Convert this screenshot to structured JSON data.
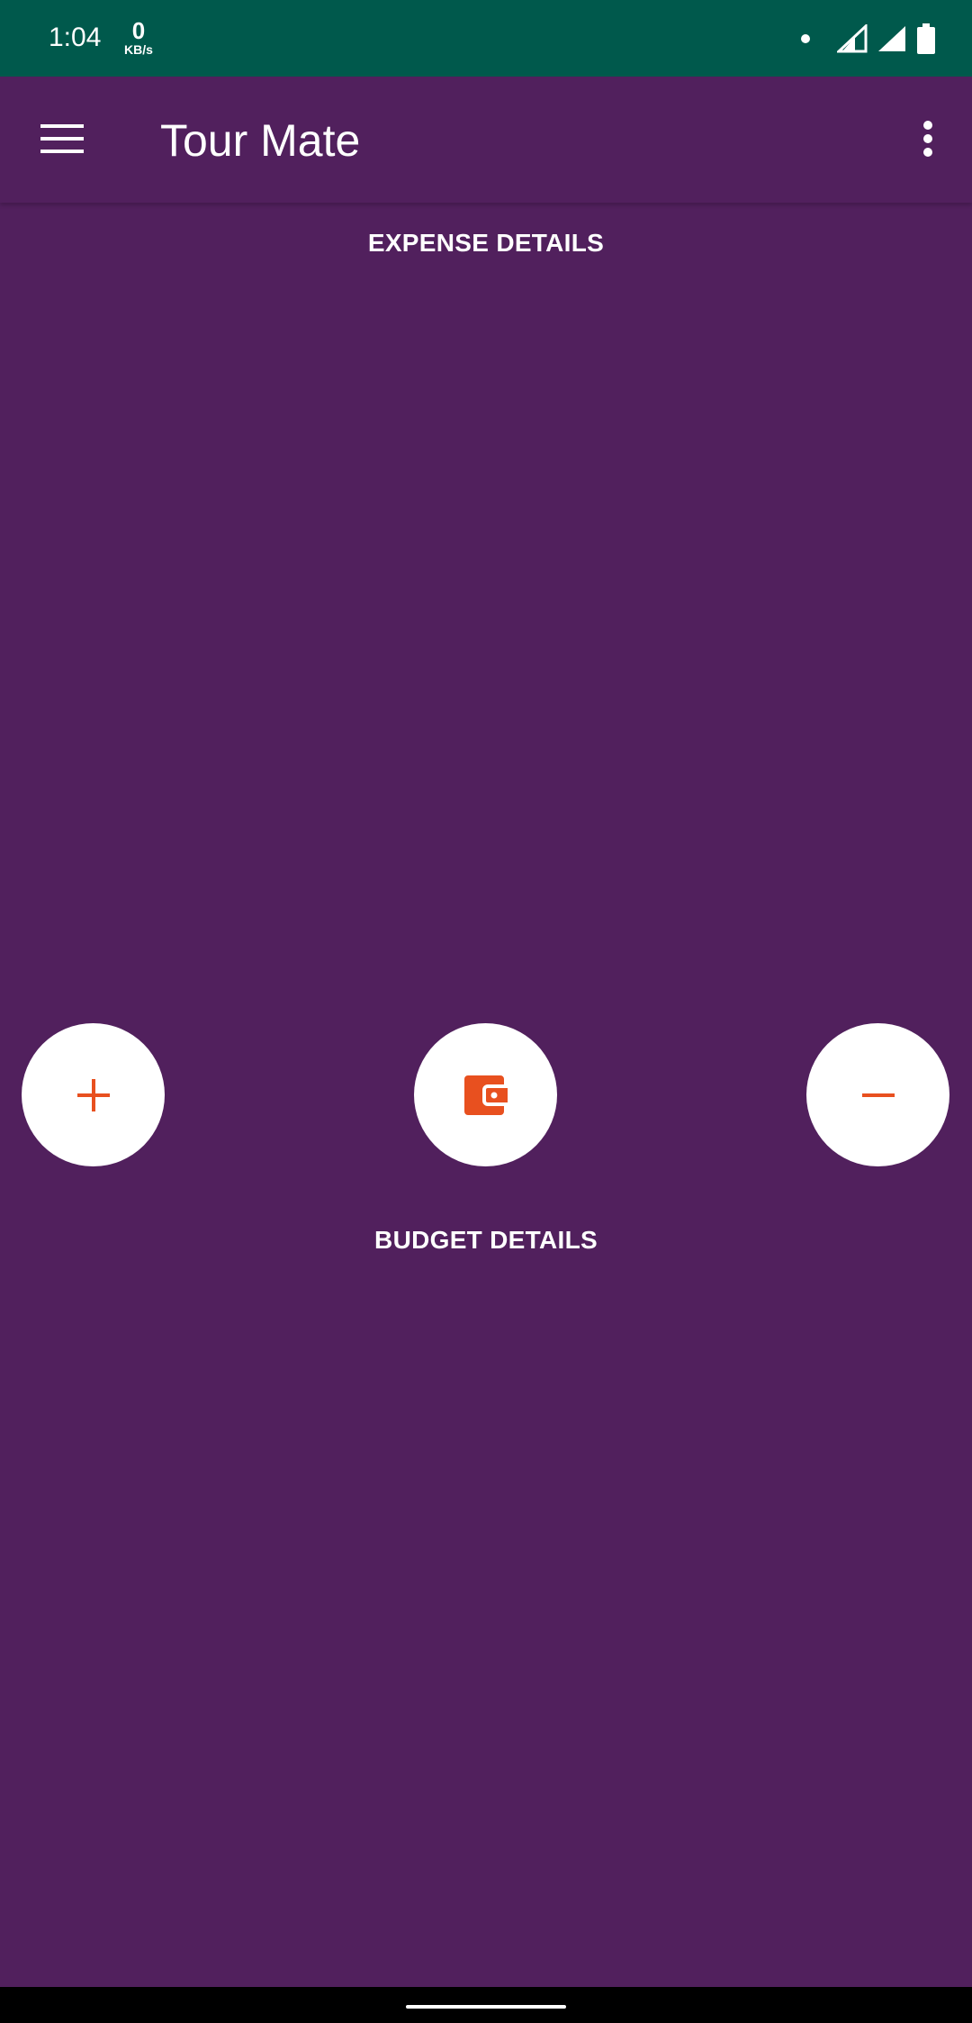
{
  "status_bar": {
    "time": "1:04",
    "speed_value": "0",
    "speed_unit": "KB/s",
    "icons": [
      "notification-dot-icon",
      "signal-icon",
      "signal-icon",
      "battery-icon"
    ]
  },
  "app_bar": {
    "title": "Tour Mate",
    "menu_icon": "hamburger-menu-icon",
    "overflow_icon": "more-vert-icon"
  },
  "sections": {
    "expense_heading": "EXPENSE DETAILS",
    "budget_heading": "BUDGET DETAILS"
  },
  "actions": {
    "add_icon": "plus-icon",
    "wallet_icon": "wallet-icon",
    "minus_icon": "minus-icon"
  },
  "colors": {
    "background": "#51205d",
    "status_bar": "#00594c",
    "accent": "#e8501f",
    "button_bg": "#ffffff"
  }
}
